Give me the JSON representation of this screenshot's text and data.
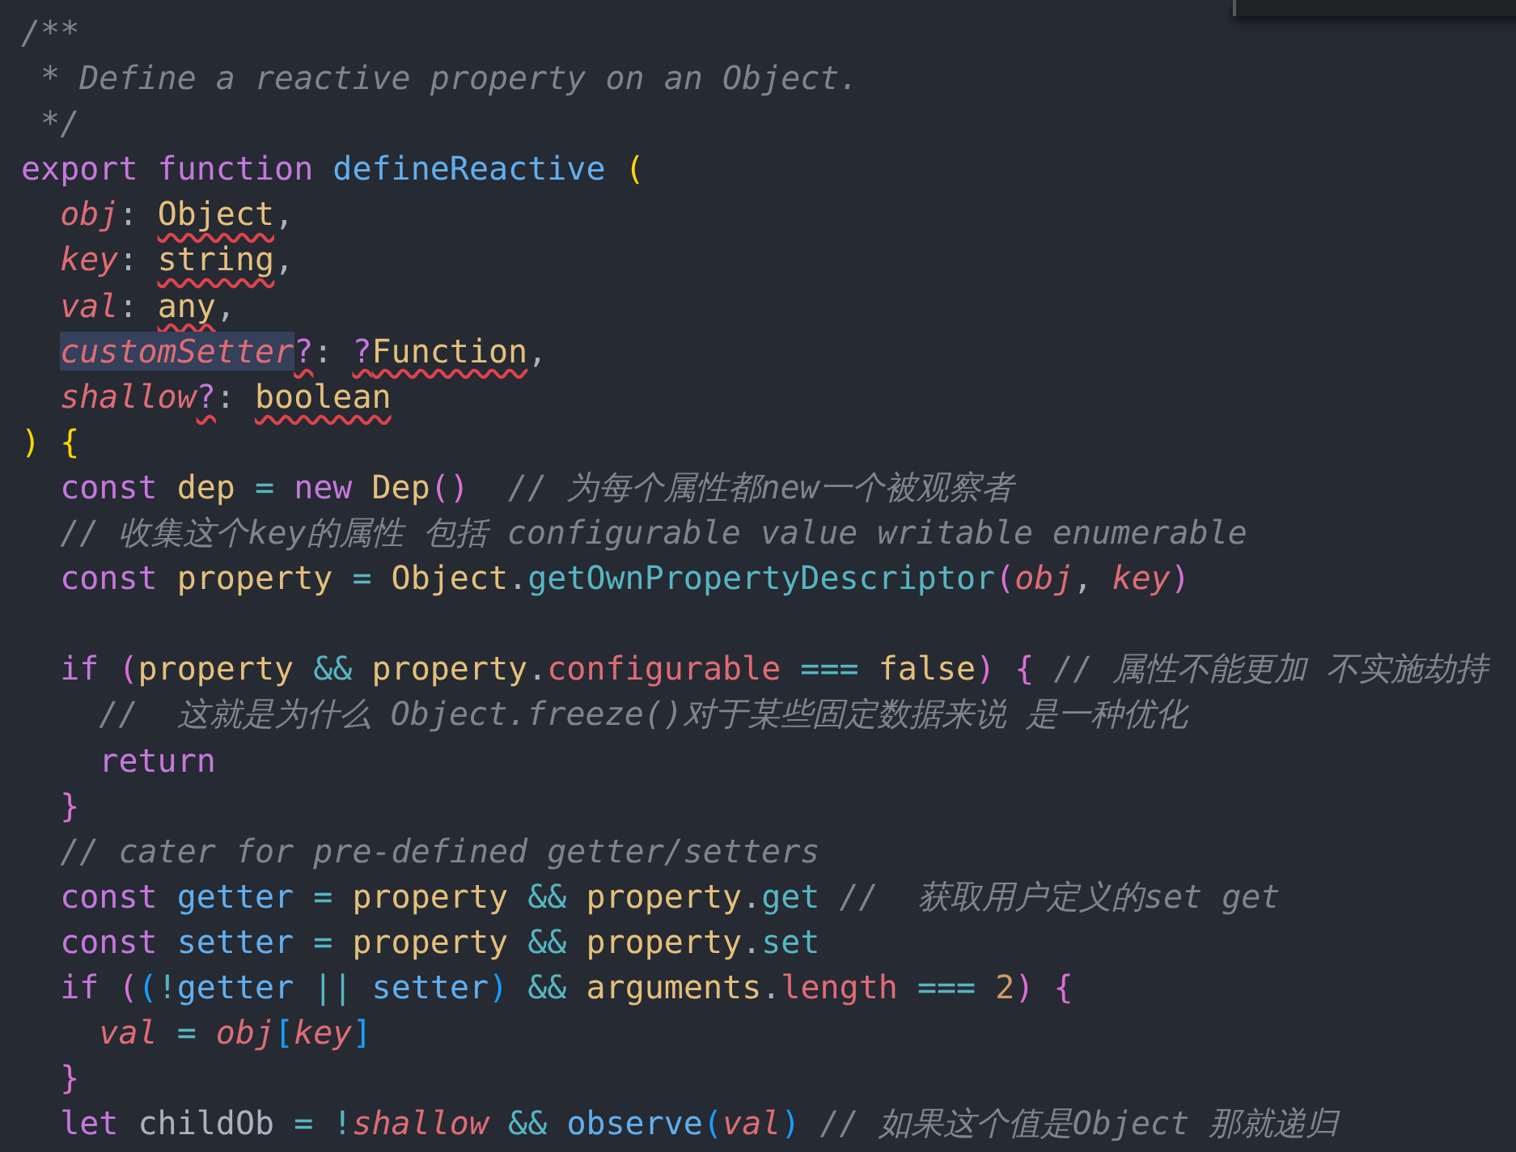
{
  "editor": {
    "lines": [
      {
        "kind": "code",
        "tokens": [
          {
            "text": "/**",
            "kind": "comment"
          }
        ]
      },
      {
        "kind": "code",
        "tokens": [
          {
            "text": " * Define a reactive property on an Object.",
            "kind": "comment"
          }
        ]
      },
      {
        "kind": "code",
        "tokens": [
          {
            "text": " */",
            "kind": "comment"
          }
        ]
      },
      {
        "kind": "code",
        "tokens": [
          {
            "text": "export function ",
            "kind": "keyword"
          },
          {
            "text": "defineReactive ",
            "kind": "function"
          },
          {
            "text": "(",
            "kind": "bracket1"
          }
        ]
      },
      {
        "kind": "code",
        "tokens": [
          {
            "text": "  obj",
            "kind": "param"
          },
          {
            "text": ": ",
            "kind": "plain"
          },
          {
            "text": "Object",
            "kind": "type-error"
          },
          {
            "text": ",",
            "kind": "plain"
          }
        ]
      },
      {
        "kind": "code",
        "tokens": [
          {
            "text": "  key",
            "kind": "param"
          },
          {
            "text": ": ",
            "kind": "plain"
          },
          {
            "text": "string",
            "kind": "type-error"
          },
          {
            "text": ",",
            "kind": "plain"
          }
        ]
      },
      {
        "kind": "code",
        "tokens": [
          {
            "text": "  val",
            "kind": "param"
          },
          {
            "text": ": ",
            "kind": "plain"
          },
          {
            "text": "any",
            "kind": "type-error"
          },
          {
            "text": ",",
            "kind": "plain"
          }
        ]
      },
      {
        "kind": "code",
        "tokens": [
          {
            "text": "customSetter",
            "kind": "param-selected"
          },
          {
            "text": "?",
            "kind": "operator-error"
          },
          {
            "text": ": ",
            "kind": "plain"
          },
          {
            "text": "?",
            "kind": "keyword-error"
          },
          {
            "text": "Function",
            "kind": "type-error"
          },
          {
            "text": ",",
            "kind": "plain"
          }
        ]
      },
      {
        "kind": "code",
        "tokens": [
          {
            "text": "  shallow",
            "kind": "param"
          },
          {
            "text": "?",
            "kind": "operator-error"
          },
          {
            "text": ": ",
            "kind": "plain"
          },
          {
            "text": "boolean",
            "kind": "type-error"
          }
        ]
      },
      {
        "kind": "code",
        "tokens": [
          {
            "text": ")",
            "kind": "bracket1"
          },
          {
            "text": " {",
            "kind": "bracket1"
          }
        ]
      },
      {
        "kind": "code",
        "tokens": [
          {
            "text": "  const ",
            "kind": "keyword"
          },
          {
            "text": "dep",
            "kind": "variable"
          },
          {
            "text": " = ",
            "kind": "operator"
          },
          {
            "text": "new ",
            "kind": "keyword"
          },
          {
            "text": "Dep",
            "kind": "variable"
          },
          {
            "text": "()",
            "kind": "bracket2"
          },
          {
            "text": "  // 为每个属性都new一个被观察者",
            "kind": "comment"
          }
        ]
      },
      {
        "kind": "code",
        "tokens": [
          {
            "text": "  // 收集这个key的属性 包括 configurable value writable enumerable",
            "kind": "comment"
          }
        ]
      },
      {
        "kind": "code",
        "tokens": [
          {
            "text": "  const ",
            "kind": "keyword"
          },
          {
            "text": "property",
            "kind": "variable"
          },
          {
            "text": " = ",
            "kind": "operator"
          },
          {
            "text": "Object",
            "kind": "variable"
          },
          {
            "text": ".",
            "kind": "plain"
          },
          {
            "text": "getOwnPropertyDescriptor",
            "kind": "method"
          },
          {
            "text": "(",
            "kind": "bracket2"
          },
          {
            "text": "obj",
            "kind": "param"
          },
          {
            "text": ", ",
            "kind": "plain"
          },
          {
            "text": "key",
            "kind": "param"
          },
          {
            "text": ")",
            "kind": "bracket2"
          }
        ]
      },
      {
        "kind": "blank"
      },
      {
        "kind": "code",
        "tokens": [
          {
            "text": "  if ",
            "kind": "keyword"
          },
          {
            "text": "(",
            "kind": "bracket2"
          },
          {
            "text": "property",
            "kind": "variable"
          },
          {
            "text": " && ",
            "kind": "operator"
          },
          {
            "text": "property",
            "kind": "variable"
          },
          {
            "text": ".",
            "kind": "plain"
          },
          {
            "text": "configurable",
            "kind": "property"
          },
          {
            "text": " === ",
            "kind": "operator"
          },
          {
            "text": "false",
            "kind": "variable"
          },
          {
            "text": ")",
            "kind": "bracket2"
          },
          {
            "text": " {",
            "kind": "bracket2"
          },
          {
            "text": " // 属性不能更加 不实施劫持",
            "kind": "comment"
          }
        ]
      },
      {
        "kind": "code",
        "tokens": [
          {
            "text": "    //  这就是为什么 Object.freeze()对于某些固定数据来说 是一种优化",
            "kind": "comment"
          }
        ]
      },
      {
        "kind": "code",
        "tokens": [
          {
            "text": "    return",
            "kind": "keyword"
          }
        ]
      },
      {
        "kind": "code",
        "tokens": [
          {
            "text": "  }",
            "kind": "bracket2"
          }
        ]
      },
      {
        "kind": "code",
        "tokens": [
          {
            "text": "  // cater for pre-defined getter/setters",
            "kind": "comment"
          }
        ]
      },
      {
        "kind": "code",
        "tokens": [
          {
            "text": "  const ",
            "kind": "keyword"
          },
          {
            "text": "getter",
            "kind": "function"
          },
          {
            "text": " = ",
            "kind": "operator"
          },
          {
            "text": "property",
            "kind": "variable"
          },
          {
            "text": " && ",
            "kind": "operator"
          },
          {
            "text": "property",
            "kind": "variable"
          },
          {
            "text": ".",
            "kind": "plain"
          },
          {
            "text": "get",
            "kind": "method"
          },
          {
            "text": " //  获取用户定义的set get",
            "kind": "comment"
          }
        ]
      },
      {
        "kind": "code",
        "tokens": [
          {
            "text": "  const ",
            "kind": "keyword"
          },
          {
            "text": "setter",
            "kind": "function"
          },
          {
            "text": " = ",
            "kind": "operator"
          },
          {
            "text": "property",
            "kind": "variable"
          },
          {
            "text": " && ",
            "kind": "operator"
          },
          {
            "text": "property",
            "kind": "variable"
          },
          {
            "text": ".",
            "kind": "plain"
          },
          {
            "text": "set",
            "kind": "method"
          }
        ]
      },
      {
        "kind": "code",
        "tokens": [
          {
            "text": "  if ",
            "kind": "keyword"
          },
          {
            "text": "(",
            "kind": "bracket2"
          },
          {
            "text": "(",
            "kind": "bracket3"
          },
          {
            "text": "!",
            "kind": "operator"
          },
          {
            "text": "getter",
            "kind": "function"
          },
          {
            "text": " || ",
            "kind": "operator"
          },
          {
            "text": "setter",
            "kind": "function"
          },
          {
            "text": ")",
            "kind": "bracket3"
          },
          {
            "text": " && ",
            "kind": "operator"
          },
          {
            "text": "arguments",
            "kind": "variable"
          },
          {
            "text": ".",
            "kind": "plain"
          },
          {
            "text": "length",
            "kind": "property"
          },
          {
            "text": " === ",
            "kind": "operator"
          },
          {
            "text": "2",
            "kind": "number"
          },
          {
            "text": ")",
            "kind": "bracket2"
          },
          {
            "text": " {",
            "kind": "bracket2"
          }
        ]
      },
      {
        "kind": "code",
        "tokens": [
          {
            "text": "    val",
            "kind": "param"
          },
          {
            "text": " = ",
            "kind": "operator"
          },
          {
            "text": "obj",
            "kind": "param"
          },
          {
            "text": "[",
            "kind": "bracket3"
          },
          {
            "text": "key",
            "kind": "param"
          },
          {
            "text": "]",
            "kind": "bracket3"
          }
        ]
      },
      {
        "kind": "code",
        "tokens": [
          {
            "text": "  }",
            "kind": "bracket2"
          }
        ]
      },
      {
        "kind": "code",
        "tokens": [
          {
            "text": "  let ",
            "kind": "keyword"
          },
          {
            "text": "childOb",
            "kind": "plain"
          },
          {
            "text": " = ",
            "kind": "operator"
          },
          {
            "text": "!",
            "kind": "operator"
          },
          {
            "text": "shallow",
            "kind": "param"
          },
          {
            "text": " && ",
            "kind": "operator"
          },
          {
            "text": "observe",
            "kind": "function"
          },
          {
            "text": "(",
            "kind": "bracket3"
          },
          {
            "text": "val",
            "kind": "param"
          },
          {
            "text": ")",
            "kind": "bracket3"
          },
          {
            "text": " // 如果这个值是Object 那就递归",
            "kind": "comment"
          }
        ]
      }
    ]
  }
}
